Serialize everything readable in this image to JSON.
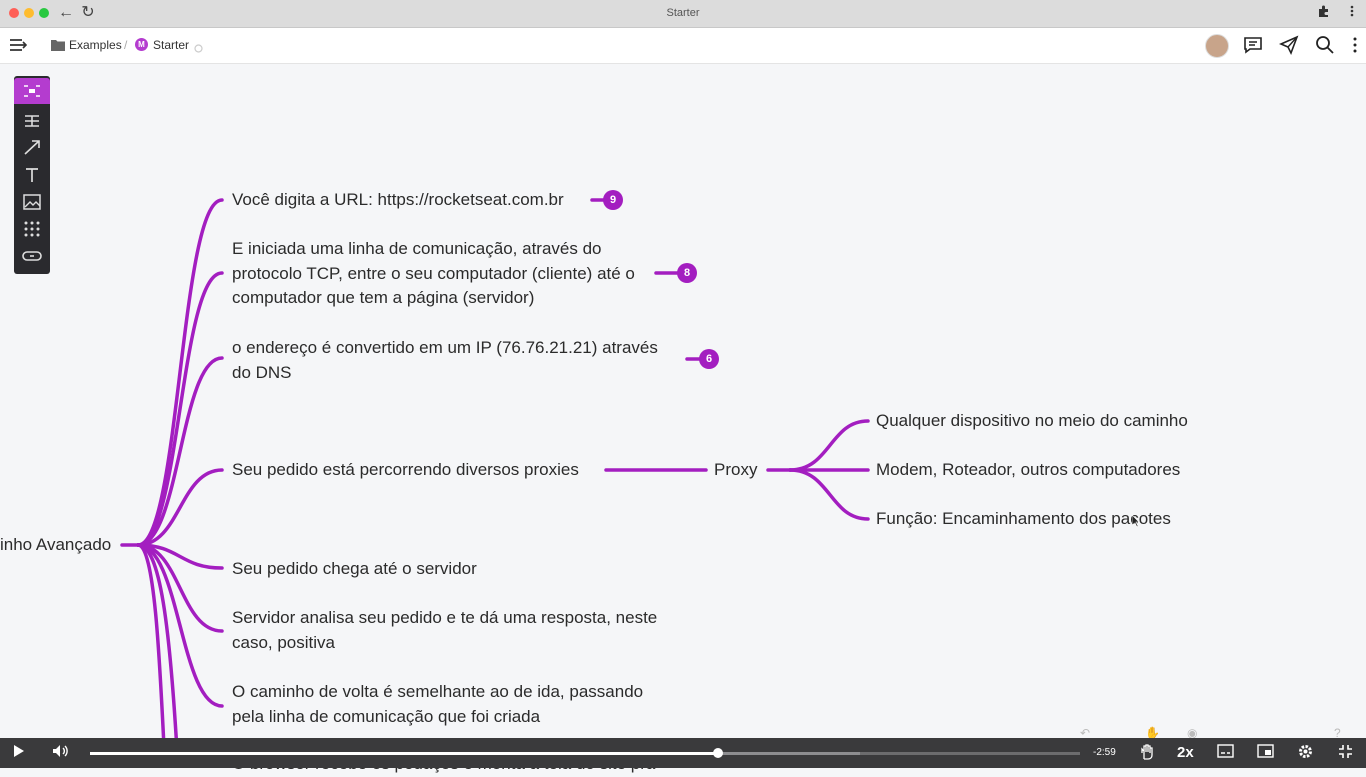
{
  "window": {
    "title": "Starter"
  },
  "header": {
    "breadcrumb": {
      "folder": "Examples",
      "separator": "/",
      "badge": "M",
      "page": "Starter"
    }
  },
  "toolbar": {
    "tools": [
      "mindmap-icon",
      "structure-icon",
      "arrow-icon",
      "text-icon",
      "image-icon",
      "grid-icon",
      "link-icon"
    ],
    "active_tool": "mindmap-icon"
  },
  "mindmap": {
    "root": "inho Avançado",
    "branches": [
      {
        "lines": [
          "Você digita a URL: https://rocketseat.com.br"
        ],
        "badge": "9"
      },
      {
        "lines": [
          "E iniciada uma linha de comunicação, através do",
          "protocolo TCP, entre o seu computador (cliente) até o",
          "computador que tem a página (servidor)"
        ],
        "badge": "8"
      },
      {
        "lines": [
          "o endereço é convertido em um IP (76.76.21.21) através",
          "do DNS"
        ],
        "badge": "6"
      },
      {
        "lines": [
          "Seu pedido está percorrendo diversos proxies"
        ]
      },
      {
        "lines": [
          "Seu pedido chega até o servidor"
        ]
      },
      {
        "lines": [
          "Servidor analisa seu pedido e te dá uma resposta, neste",
          "caso, positiva"
        ]
      },
      {
        "lines": [
          "O caminho de volta é semelhante ao de ida, passando",
          "pela linha de comunicação que foi criada"
        ]
      },
      {
        "lines": [
          "O browser recebe os pedaços e monta a tela do site pra"
        ]
      }
    ],
    "proxy": {
      "label": "Proxy",
      "children": [
        "Qualquer dispositivo no meio do caminho",
        "Modem, Roteador, outros computadores",
        "Função: Encaminhamento dos pacotes"
      ]
    },
    "colors": {
      "line": "#a31ec0",
      "accent": "#b43ccf"
    }
  },
  "player": {
    "time_remaining": "-2:59",
    "speed": "2x",
    "progress": 0.634,
    "buffered": 0.778
  }
}
